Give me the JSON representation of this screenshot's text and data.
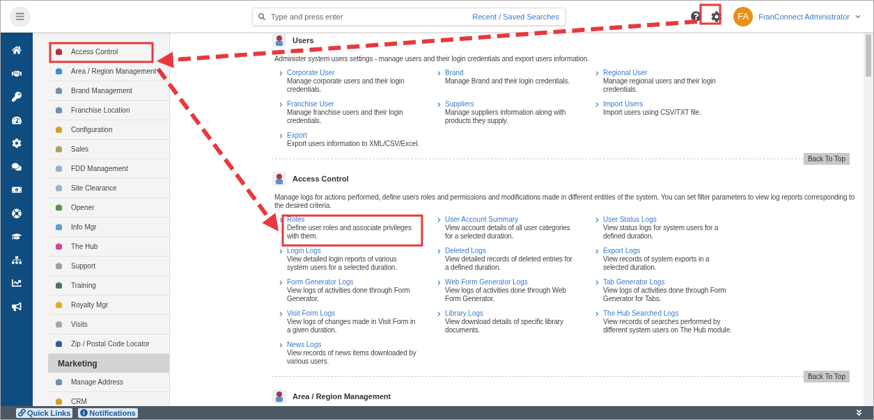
{
  "topbar": {
    "search": {
      "placeholder": "Type and press enter"
    },
    "recent_link": "Recent / Saved Searches",
    "avatar": "FA",
    "user": "FranConnect Administrator"
  },
  "sidebar": {
    "items": [
      {
        "label": "Access Control"
      },
      {
        "label": "Area / Region Management"
      },
      {
        "label": "Brand Management"
      },
      {
        "label": "Franchise Location"
      },
      {
        "label": "Configuration"
      },
      {
        "label": "Sales"
      },
      {
        "label": "FDD Management"
      },
      {
        "label": "Site Clearance"
      },
      {
        "label": "Opener"
      },
      {
        "label": "Info Mgr"
      },
      {
        "label": "The Hub"
      },
      {
        "label": "Support"
      },
      {
        "label": "Training"
      },
      {
        "label": "Royalty Mgr"
      },
      {
        "label": "Visits"
      },
      {
        "label": "Zip / Postal Code Locator"
      }
    ],
    "group": "Marketing",
    "group_items": [
      {
        "label": "Manage Address"
      },
      {
        "label": "CRM"
      }
    ]
  },
  "sections": [
    {
      "title": "Users",
      "description": "Administer system users settings - manage users and their login credentials and export users information.",
      "links": [
        {
          "title": "Corporate User",
          "text": "Manage corporate users and their login credentials."
        },
        {
          "title": "Brand",
          "text": "Manage Brand and their login credentials."
        },
        {
          "title": "Regional User",
          "text": "Manage regional users and their login credentials."
        },
        {
          "title": "Franchise User",
          "text": "Manage franchise users and their login credentials."
        },
        {
          "title": "Suppliers",
          "text": "Manage suppliers information along with products they supply."
        },
        {
          "title": "Import Users",
          "text": "Import users using CSV/TXT file."
        },
        {
          "title": "Export",
          "text": "Export users information to XML/CSV/Excel."
        }
      ],
      "back_to_top": "Back To Top"
    },
    {
      "title": "Access Control",
      "description": "Manage logs for actions performed, define users roles and permissions and modifications made in different entities of the system. You can set filter parameters to view log reports corresponding to the desired criteria.",
      "links": [
        {
          "title": "Roles",
          "text": "Define user roles and associate privileges with them."
        },
        {
          "title": "User Account Summary",
          "text": "View account details of all user categories for a selected duration."
        },
        {
          "title": "User Status Logs",
          "text": "View status logs for system users for a defined duration."
        },
        {
          "title": "Login Logs",
          "text": "View detailed login reports of various system users for a selected duration."
        },
        {
          "title": "Deleted Logs",
          "text": "View detailed records of deleted entries for a defined duration."
        },
        {
          "title": "Export Logs",
          "text": "View records of system exports in a selected duration."
        },
        {
          "title": "Form Generator Logs",
          "text": "View logs of activities done through Form Generator."
        },
        {
          "title": "Web Form Generator Logs",
          "text": "View logs of activities done through Web Form Generator."
        },
        {
          "title": "Tab Generator Logs",
          "text": "View logs of activities done through Form Generator for Tabs."
        },
        {
          "title": "Visit Form Logs",
          "text": "View logs of changes made in Visit Form in a given duration."
        },
        {
          "title": "Library Logs",
          "text": "View download details of specific library documents."
        },
        {
          "title": "The Hub Searched Logs",
          "text": "View records of searches performed by different system users on The Hub module."
        },
        {
          "title": "News Logs",
          "text": "View records of news items downloaded by various users."
        }
      ],
      "back_to_top": "Back To Top"
    },
    {
      "title": "Area / Region Management"
    }
  ],
  "bottom_bar": {
    "buttons": [
      {
        "label": "Quick Links"
      },
      {
        "label": "Notifications"
      }
    ]
  }
}
